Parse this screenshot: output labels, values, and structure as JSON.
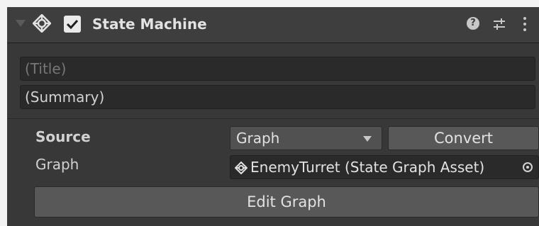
{
  "component": {
    "title": "State Machine",
    "enabled": true,
    "icon": "state-machine-icon",
    "header_icons": [
      "help-icon",
      "preset-icon",
      "kebab-menu-icon"
    ]
  },
  "fields": {
    "title_placeholder": "(Title)",
    "summary_value": "(Summary)"
  },
  "source": {
    "label": "Source",
    "selected": "Graph",
    "convert_label": "Convert"
  },
  "graph": {
    "label": "Graph",
    "asset_name": "EnemyTurret (State Graph Asset)",
    "asset_icon": "state-graph-asset-icon",
    "picker_icon": "object-picker-icon"
  },
  "actions": {
    "edit_graph_label": "Edit Graph"
  },
  "colors": {
    "panel_bg": "#383838",
    "header_bg": "#3e3e3e",
    "field_bg": "#2a2a2a",
    "button_bg": "#585858"
  }
}
